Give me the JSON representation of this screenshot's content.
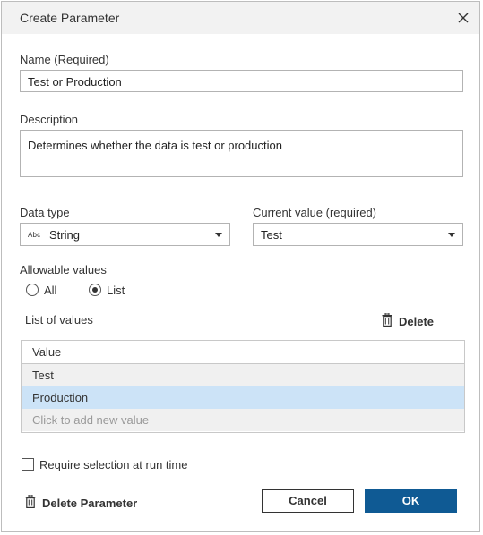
{
  "dialog": {
    "title": "Create Parameter",
    "close_icon": "close-icon"
  },
  "name": {
    "label": "Name (Required)",
    "value": "Test or Production"
  },
  "description": {
    "label": "Description",
    "value": "Determines whether the data is test or production"
  },
  "data_type": {
    "label": "Data type",
    "type_badge": "Abc",
    "value": "String"
  },
  "current_value": {
    "label": "Current value (required)",
    "value": "Test"
  },
  "allowable_values": {
    "label": "Allowable values",
    "options": [
      "All",
      "List"
    ],
    "selected": "List"
  },
  "list_of_values": {
    "label": "List of values",
    "delete_label": "Delete",
    "column_header": "Value",
    "rows": [
      "Test",
      "Production"
    ],
    "selected_row": "Production",
    "add_placeholder": "Click to add new value"
  },
  "require_selection": {
    "label": "Require selection at run time",
    "checked": false
  },
  "footer": {
    "delete_parameter_label": "Delete Parameter",
    "cancel_label": "Cancel",
    "ok_label": "OK"
  },
  "colors": {
    "ok_button": "#0f5a94",
    "selected_row": "#cce3f7",
    "row_alt": "#f0f0f0"
  }
}
